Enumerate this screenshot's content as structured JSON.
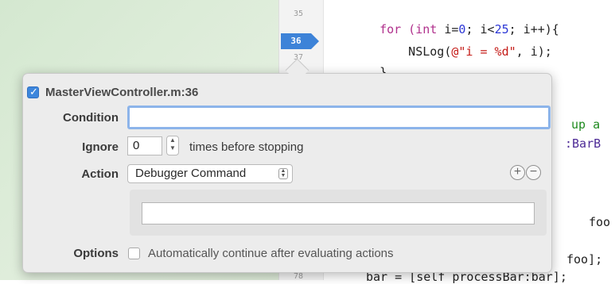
{
  "editor": {
    "line_numbers": [
      "35",
      "36",
      "37",
      "78"
    ],
    "current_line": "36",
    "code_lines": [
      {
        "parts": [
          {
            "t": "for (",
            "c": "kw"
          },
          {
            "t": "int",
            "c": "kw"
          },
          {
            "t": " i=",
            "c": ""
          },
          {
            "t": "0",
            "c": "num"
          },
          {
            "t": "; i<",
            "c": ""
          },
          {
            "t": "25",
            "c": "num"
          },
          {
            "t": "; i++){",
            "c": ""
          }
        ]
      },
      {
        "parts": [
          {
            "t": "    NSLog(",
            "c": ""
          },
          {
            "t": "@\"i = %d\"",
            "c": "str"
          },
          {
            "t": ", i);",
            "c": ""
          }
        ]
      },
      {
        "parts": [
          {
            "t": "}",
            "c": ""
          }
        ]
      }
    ],
    "peek_right": [
      {
        "text": "up a",
        "color": "cmt"
      },
      {
        "text": ":BarB",
        "color": "cls"
      },
      {
        "text": "foo",
        "color": ""
      },
      {
        "text": "foo];",
        "color": ""
      },
      {
        "text": "bar = [self processBar:bar];",
        "color": ""
      }
    ]
  },
  "breakpoint": {
    "enabled": true,
    "title": "MasterViewController.m:36",
    "condition_label": "Condition",
    "condition_value": "",
    "ignore_label": "Ignore",
    "ignore_value": "0",
    "ignore_suffix": "times before stopping",
    "action_label": "Action",
    "action_value": "Debugger Command",
    "action_command_value": "",
    "options_label": "Options",
    "auto_continue_checked": false,
    "auto_continue_text": "Automatically continue after evaluating actions"
  },
  "icons": {
    "add": "plus-circle-icon",
    "remove": "minus-circle-icon",
    "stepper": "stepper-icon",
    "popup": "popup-chevron-icon"
  },
  "colors": {
    "accent": "#3d83d8",
    "focus_ring": "#8cb4ea",
    "popover_bg": "#ececec"
  }
}
